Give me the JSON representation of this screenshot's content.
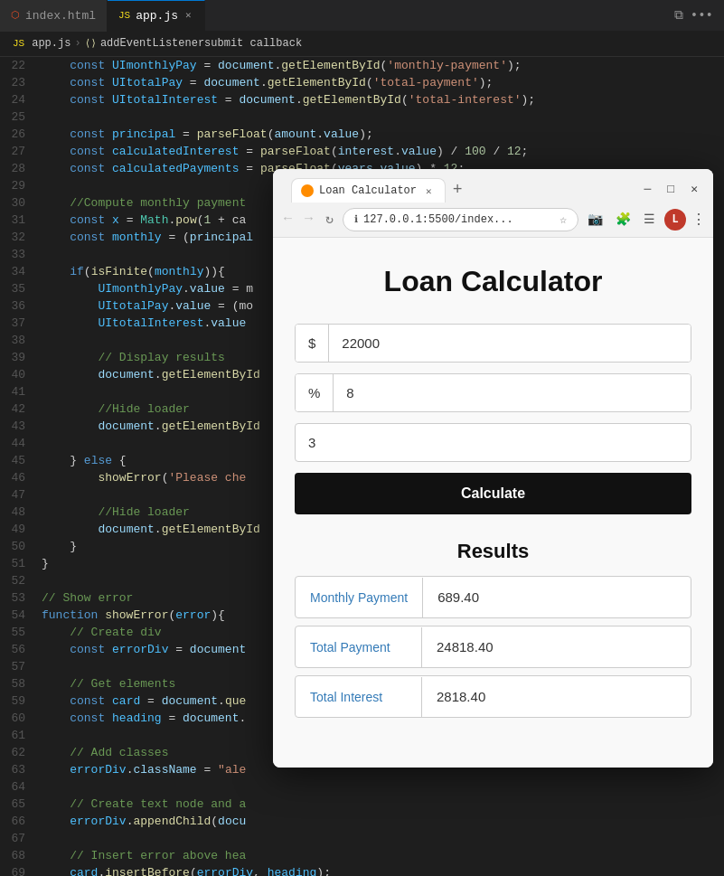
{
  "editor": {
    "tabs": [
      {
        "id": "index-html",
        "icon": "html-icon",
        "label": "index.html",
        "active": false
      },
      {
        "id": "app-js",
        "icon": "js-icon",
        "label": "app.js",
        "active": true,
        "closable": true
      }
    ],
    "breadcrumb": {
      "parts": [
        "JS app.js",
        ">",
        "addEventListenersubmit callback"
      ]
    },
    "lines": [
      {
        "num": "22",
        "tokens": [
          {
            "t": "    ",
            "c": ""
          },
          {
            "t": "const ",
            "c": "kw"
          },
          {
            "t": "UImonthlyPay",
            "c": "var"
          },
          {
            "t": " = ",
            "c": "punc"
          },
          {
            "t": "document",
            "c": "prop"
          },
          {
            "t": ".",
            "c": "punc"
          },
          {
            "t": "getElementById",
            "c": "fn"
          },
          {
            "t": "(",
            "c": "punc"
          },
          {
            "t": "'monthly-payment'",
            "c": "str"
          },
          {
            "t": ");",
            "c": "punc"
          }
        ]
      },
      {
        "num": "23",
        "tokens": [
          {
            "t": "    ",
            "c": ""
          },
          {
            "t": "const ",
            "c": "kw"
          },
          {
            "t": "UItotalPay",
            "c": "var"
          },
          {
            "t": " = ",
            "c": "punc"
          },
          {
            "t": "document",
            "c": "prop"
          },
          {
            "t": ".",
            "c": "punc"
          },
          {
            "t": "getElementById",
            "c": "fn"
          },
          {
            "t": "(",
            "c": "punc"
          },
          {
            "t": "'total-payment'",
            "c": "str"
          },
          {
            "t": ");",
            "c": "punc"
          }
        ]
      },
      {
        "num": "24",
        "tokens": [
          {
            "t": "    ",
            "c": ""
          },
          {
            "t": "const ",
            "c": "kw"
          },
          {
            "t": "UItotalInterest",
            "c": "var"
          },
          {
            "t": " = ",
            "c": "punc"
          },
          {
            "t": "document",
            "c": "prop"
          },
          {
            "t": ".",
            "c": "punc"
          },
          {
            "t": "getElementById",
            "c": "fn"
          },
          {
            "t": "(",
            "c": "punc"
          },
          {
            "t": "'total-interest'",
            "c": "str"
          },
          {
            "t": ");",
            "c": "punc"
          }
        ]
      },
      {
        "num": "25",
        "tokens": []
      },
      {
        "num": "26",
        "tokens": [
          {
            "t": "    ",
            "c": ""
          },
          {
            "t": "const ",
            "c": "kw"
          },
          {
            "t": "principal",
            "c": "var"
          },
          {
            "t": " = ",
            "c": "punc"
          },
          {
            "t": "parseFloat",
            "c": "fn"
          },
          {
            "t": "(",
            "c": "punc"
          },
          {
            "t": "amount",
            "c": "prop"
          },
          {
            "t": ".",
            "c": "punc"
          },
          {
            "t": "value",
            "c": "prop"
          },
          {
            "t": ");",
            "c": "punc"
          }
        ]
      },
      {
        "num": "27",
        "tokens": [
          {
            "t": "    ",
            "c": ""
          },
          {
            "t": "const ",
            "c": "kw"
          },
          {
            "t": "calculatedInterest",
            "c": "var"
          },
          {
            "t": " = ",
            "c": "punc"
          },
          {
            "t": "parseFloat",
            "c": "fn"
          },
          {
            "t": "(",
            "c": "punc"
          },
          {
            "t": "interest",
            "c": "prop"
          },
          {
            "t": ".",
            "c": "punc"
          },
          {
            "t": "value",
            "c": "prop"
          },
          {
            "t": ") / ",
            "c": "punc"
          },
          {
            "t": "100",
            "c": "num"
          },
          {
            "t": " / ",
            "c": "punc"
          },
          {
            "t": "12",
            "c": "num"
          },
          {
            "t": ";",
            "c": "punc"
          }
        ]
      },
      {
        "num": "28",
        "tokens": [
          {
            "t": "    ",
            "c": ""
          },
          {
            "t": "const ",
            "c": "kw"
          },
          {
            "t": "calculatedPayments",
            "c": "var"
          },
          {
            "t": " = ",
            "c": "punc"
          },
          {
            "t": "parseFloat",
            "c": "fn"
          },
          {
            "t": "(",
            "c": "punc"
          },
          {
            "t": "years",
            "c": "prop"
          },
          {
            "t": ".",
            "c": "punc"
          },
          {
            "t": "value",
            "c": "prop"
          },
          {
            "t": ") * ",
            "c": "punc"
          },
          {
            "t": "12",
            "c": "num"
          },
          {
            "t": ";",
            "c": "punc"
          }
        ]
      },
      {
        "num": "29",
        "tokens": []
      },
      {
        "num": "30",
        "tokens": [
          {
            "t": "    ",
            "c": ""
          },
          {
            "t": "//Compute monthly payment",
            "c": "cmt"
          }
        ]
      },
      {
        "num": "31",
        "tokens": [
          {
            "t": "    ",
            "c": ""
          },
          {
            "t": "const ",
            "c": "kw"
          },
          {
            "t": "x",
            "c": "var"
          },
          {
            "t": " = ",
            "c": "punc"
          },
          {
            "t": "Math",
            "c": "cls"
          },
          {
            "t": ".",
            "c": "punc"
          },
          {
            "t": "pow",
            "c": "fn"
          },
          {
            "t": "(",
            "c": "punc"
          },
          {
            "t": "1",
            "c": "num"
          },
          {
            "t": " + ca",
            "c": "punc"
          }
        ]
      },
      {
        "num": "32",
        "tokens": [
          {
            "t": "    ",
            "c": ""
          },
          {
            "t": "const ",
            "c": "kw"
          },
          {
            "t": "monthly",
            "c": "var"
          },
          {
            "t": " = (",
            "c": "punc"
          },
          {
            "t": "principal",
            "c": "prop"
          }
        ]
      },
      {
        "num": "33",
        "tokens": []
      },
      {
        "num": "34",
        "tokens": [
          {
            "t": "    ",
            "c": ""
          },
          {
            "t": "if",
            "c": "kw"
          },
          {
            "t": "(",
            "c": "punc"
          },
          {
            "t": "isFinite",
            "c": "fn"
          },
          {
            "t": "(",
            "c": "punc"
          },
          {
            "t": "monthly",
            "c": "var"
          },
          {
            "t": ")){",
            "c": "punc"
          }
        ]
      },
      {
        "num": "35",
        "tokens": [
          {
            "t": "        ",
            "c": ""
          },
          {
            "t": "UImonthlyPay",
            "c": "var"
          },
          {
            "t": ".",
            "c": "punc"
          },
          {
            "t": "value",
            "c": "prop"
          },
          {
            "t": " = m",
            "c": "punc"
          }
        ]
      },
      {
        "num": "36",
        "tokens": [
          {
            "t": "        ",
            "c": ""
          },
          {
            "t": "UItotalPay",
            "c": "var"
          },
          {
            "t": ".",
            "c": "punc"
          },
          {
            "t": "value",
            "c": "prop"
          },
          {
            "t": " = (mo",
            "c": "punc"
          }
        ]
      },
      {
        "num": "37",
        "tokens": [
          {
            "t": "        ",
            "c": ""
          },
          {
            "t": "UItotalInterest",
            "c": "var"
          },
          {
            "t": ".",
            "c": "punc"
          },
          {
            "t": "value",
            "c": "prop"
          }
        ]
      },
      {
        "num": "38",
        "tokens": []
      },
      {
        "num": "39",
        "tokens": [
          {
            "t": "        ",
            "c": ""
          },
          {
            "t": "// Display results",
            "c": "cmt"
          }
        ]
      },
      {
        "num": "40",
        "tokens": [
          {
            "t": "        ",
            "c": ""
          },
          {
            "t": "document",
            "c": "prop"
          },
          {
            "t": ".",
            "c": "punc"
          },
          {
            "t": "getElementById",
            "c": "fn"
          }
        ]
      },
      {
        "num": "41",
        "tokens": []
      },
      {
        "num": "42",
        "tokens": [
          {
            "t": "        ",
            "c": ""
          },
          {
            "t": "//Hide loader",
            "c": "cmt"
          }
        ]
      },
      {
        "num": "43",
        "tokens": [
          {
            "t": "        ",
            "c": ""
          },
          {
            "t": "document",
            "c": "prop"
          },
          {
            "t": ".",
            "c": "punc"
          },
          {
            "t": "getElementById",
            "c": "fn"
          }
        ]
      },
      {
        "num": "44",
        "tokens": []
      },
      {
        "num": "45",
        "tokens": [
          {
            "t": "    ",
            "c": ""
          },
          {
            "t": "} ",
            "c": "punc"
          },
          {
            "t": "else",
            "c": "kw"
          },
          {
            "t": " {",
            "c": "punc"
          }
        ]
      },
      {
        "num": "46",
        "tokens": [
          {
            "t": "        ",
            "c": ""
          },
          {
            "t": "showError",
            "c": "fn"
          },
          {
            "t": "(",
            "c": "punc"
          },
          {
            "t": "'Please che",
            "c": "str"
          }
        ]
      },
      {
        "num": "47",
        "tokens": []
      },
      {
        "num": "48",
        "tokens": [
          {
            "t": "        ",
            "c": ""
          },
          {
            "t": "//Hide loader",
            "c": "cmt"
          }
        ]
      },
      {
        "num": "49",
        "tokens": [
          {
            "t": "        ",
            "c": ""
          },
          {
            "t": "document",
            "c": "prop"
          },
          {
            "t": ".",
            "c": "punc"
          },
          {
            "t": "getElementById",
            "c": "fn"
          }
        ]
      },
      {
        "num": "50",
        "tokens": [
          {
            "t": "    ",
            "c": ""
          },
          {
            "t": "}",
            "c": "punc"
          }
        ]
      },
      {
        "num": "51",
        "tokens": [
          {
            "t": "}",
            "c": "punc"
          }
        ]
      },
      {
        "num": "52",
        "tokens": []
      },
      {
        "num": "53",
        "tokens": [
          {
            "t": "",
            "c": ""
          },
          {
            "t": "// Show error",
            "c": "cmt"
          }
        ]
      },
      {
        "num": "54",
        "tokens": [
          {
            "t": "",
            "c": ""
          },
          {
            "t": "function ",
            "c": "kw"
          },
          {
            "t": "showError",
            "c": "fn"
          },
          {
            "t": "(",
            "c": "punc"
          },
          {
            "t": "error",
            "c": "var"
          },
          {
            "t": "){",
            "c": "punc"
          }
        ]
      },
      {
        "num": "55",
        "tokens": [
          {
            "t": "    ",
            "c": ""
          },
          {
            "t": "// Create div",
            "c": "cmt"
          }
        ]
      },
      {
        "num": "56",
        "tokens": [
          {
            "t": "    ",
            "c": ""
          },
          {
            "t": "const ",
            "c": "kw"
          },
          {
            "t": "errorDiv",
            "c": "var"
          },
          {
            "t": " = ",
            "c": "punc"
          },
          {
            "t": "document",
            "c": "prop"
          }
        ]
      },
      {
        "num": "57",
        "tokens": []
      },
      {
        "num": "58",
        "tokens": [
          {
            "t": "    ",
            "c": ""
          },
          {
            "t": "// Get elements",
            "c": "cmt"
          }
        ]
      },
      {
        "num": "59",
        "tokens": [
          {
            "t": "    ",
            "c": ""
          },
          {
            "t": "const ",
            "c": "kw"
          },
          {
            "t": "card",
            "c": "var"
          },
          {
            "t": " = ",
            "c": "punc"
          },
          {
            "t": "document",
            "c": "prop"
          },
          {
            "t": ".",
            "c": "punc"
          },
          {
            "t": "que",
            "c": "fn"
          }
        ]
      },
      {
        "num": "60",
        "tokens": [
          {
            "t": "    ",
            "c": ""
          },
          {
            "t": "const ",
            "c": "kw"
          },
          {
            "t": "heading",
            "c": "var"
          },
          {
            "t": " = ",
            "c": "punc"
          },
          {
            "t": "document",
            "c": "prop"
          },
          {
            "t": ".",
            "c": "punc"
          }
        ]
      },
      {
        "num": "61",
        "tokens": []
      },
      {
        "num": "62",
        "tokens": [
          {
            "t": "    ",
            "c": ""
          },
          {
            "t": "// Add classes",
            "c": "cmt"
          }
        ]
      },
      {
        "num": "63",
        "tokens": [
          {
            "t": "    ",
            "c": ""
          },
          {
            "t": "errorDiv",
            "c": "var"
          },
          {
            "t": ".",
            "c": "punc"
          },
          {
            "t": "className",
            "c": "prop"
          },
          {
            "t": " = ",
            "c": "punc"
          },
          {
            "t": "\"ale",
            "c": "str"
          }
        ]
      },
      {
        "num": "64",
        "tokens": []
      },
      {
        "num": "65",
        "tokens": [
          {
            "t": "    ",
            "c": ""
          },
          {
            "t": "// Create text node and a",
            "c": "cmt"
          }
        ]
      },
      {
        "num": "66",
        "tokens": [
          {
            "t": "    ",
            "c": ""
          },
          {
            "t": "errorDiv",
            "c": "var"
          },
          {
            "t": ".",
            "c": "punc"
          },
          {
            "t": "appendChild",
            "c": "fn"
          },
          {
            "t": "(",
            "c": "punc"
          },
          {
            "t": "docu",
            "c": "prop"
          }
        ]
      },
      {
        "num": "67",
        "tokens": []
      },
      {
        "num": "68",
        "tokens": [
          {
            "t": "    ",
            "c": ""
          },
          {
            "t": "// Insert error above hea",
            "c": "cmt"
          }
        ]
      },
      {
        "num": "69",
        "tokens": [
          {
            "t": "    ",
            "c": ""
          },
          {
            "t": "card",
            "c": "var"
          },
          {
            "t": ".",
            "c": "punc"
          },
          {
            "t": "insertBefore",
            "c": "fn"
          },
          {
            "t": "(",
            "c": "punc"
          },
          {
            "t": "errorDiv",
            "c": "var"
          },
          {
            "t": ", ",
            "c": "punc"
          },
          {
            "t": "heading",
            "c": "var"
          },
          {
            "t": ");",
            "c": "punc"
          }
        ]
      }
    ]
  },
  "browser": {
    "tab_label": "Loan Calculator",
    "url": "127.0.0.1:5500/index...",
    "title": "Loan Calculator",
    "amount_prefix": "$",
    "amount_value": "22000",
    "amount_placeholder": "",
    "interest_prefix": "%",
    "interest_value": "8",
    "interest_placeholder": "",
    "years_value": "3",
    "years_placeholder": "",
    "calc_button": "Calculate",
    "results_title": "Results",
    "results": [
      {
        "label": "Monthly Payment",
        "value": "689.40"
      },
      {
        "label": "Total Payment",
        "value": "24818.40"
      },
      {
        "label": "Total Interest",
        "value": "2818.40"
      }
    ]
  }
}
